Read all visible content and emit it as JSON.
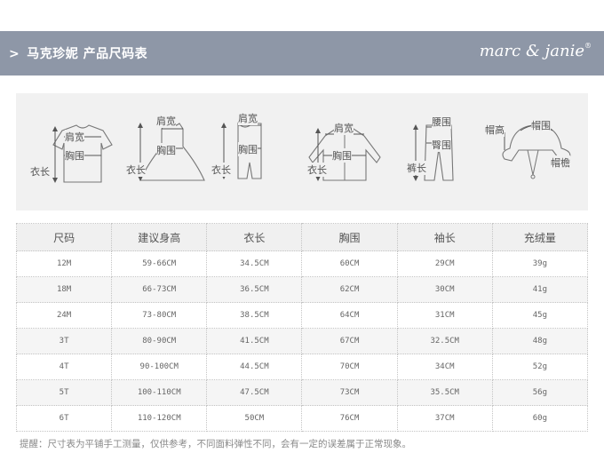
{
  "header": {
    "arrow": ">",
    "title": "马克珍妮  产品尺码表",
    "brand": "marc & janie",
    "trademark": "®"
  },
  "diagrams": {
    "tshirt": {
      "shoulder": "肩宽",
      "chest": "胸围",
      "length": "衣长"
    },
    "dress": {
      "shoulder": "肩宽",
      "chest": "胸围",
      "length": "衣长"
    },
    "romper": {
      "shoulder": "肩宽",
      "chest": "胸围",
      "length": "衣长"
    },
    "jacket": {
      "shoulder": "肩宽",
      "chest": "胸围",
      "length": "衣长"
    },
    "pants": {
      "waist": "腰围",
      "hip": "臀围",
      "length": "裤长"
    },
    "hat": {
      "height": "帽高",
      "circumference": "帽围",
      "brim": "帽檐"
    }
  },
  "table": {
    "headers": [
      "尺码",
      "建议身高",
      "衣长",
      "胸围",
      "袖长",
      "充绒量"
    ],
    "rows": [
      [
        "12M",
        "59-66CM",
        "34.5CM",
        "60CM",
        "29CM",
        "39g"
      ],
      [
        "18M",
        "66-73CM",
        "36.5CM",
        "62CM",
        "30CM",
        "41g"
      ],
      [
        "24M",
        "73-80CM",
        "38.5CM",
        "64CM",
        "31CM",
        "45g"
      ],
      [
        "3T",
        "80-90CM",
        "41.5CM",
        "67CM",
        "32.5CM",
        "48g"
      ],
      [
        "4T",
        "90-100CM",
        "44.5CM",
        "70CM",
        "34CM",
        "52g"
      ],
      [
        "5T",
        "100-110CM",
        "47.5CM",
        "73CM",
        "35.5CM",
        "56g"
      ],
      [
        "6T",
        "110-120CM",
        "50CM",
        "76CM",
        "37CM",
        "60g"
      ]
    ]
  },
  "note": "提醒：尺寸表为平铺手工测量，仅供参考，不同面料弹性不同，会有一定的误差属于正常现象。"
}
